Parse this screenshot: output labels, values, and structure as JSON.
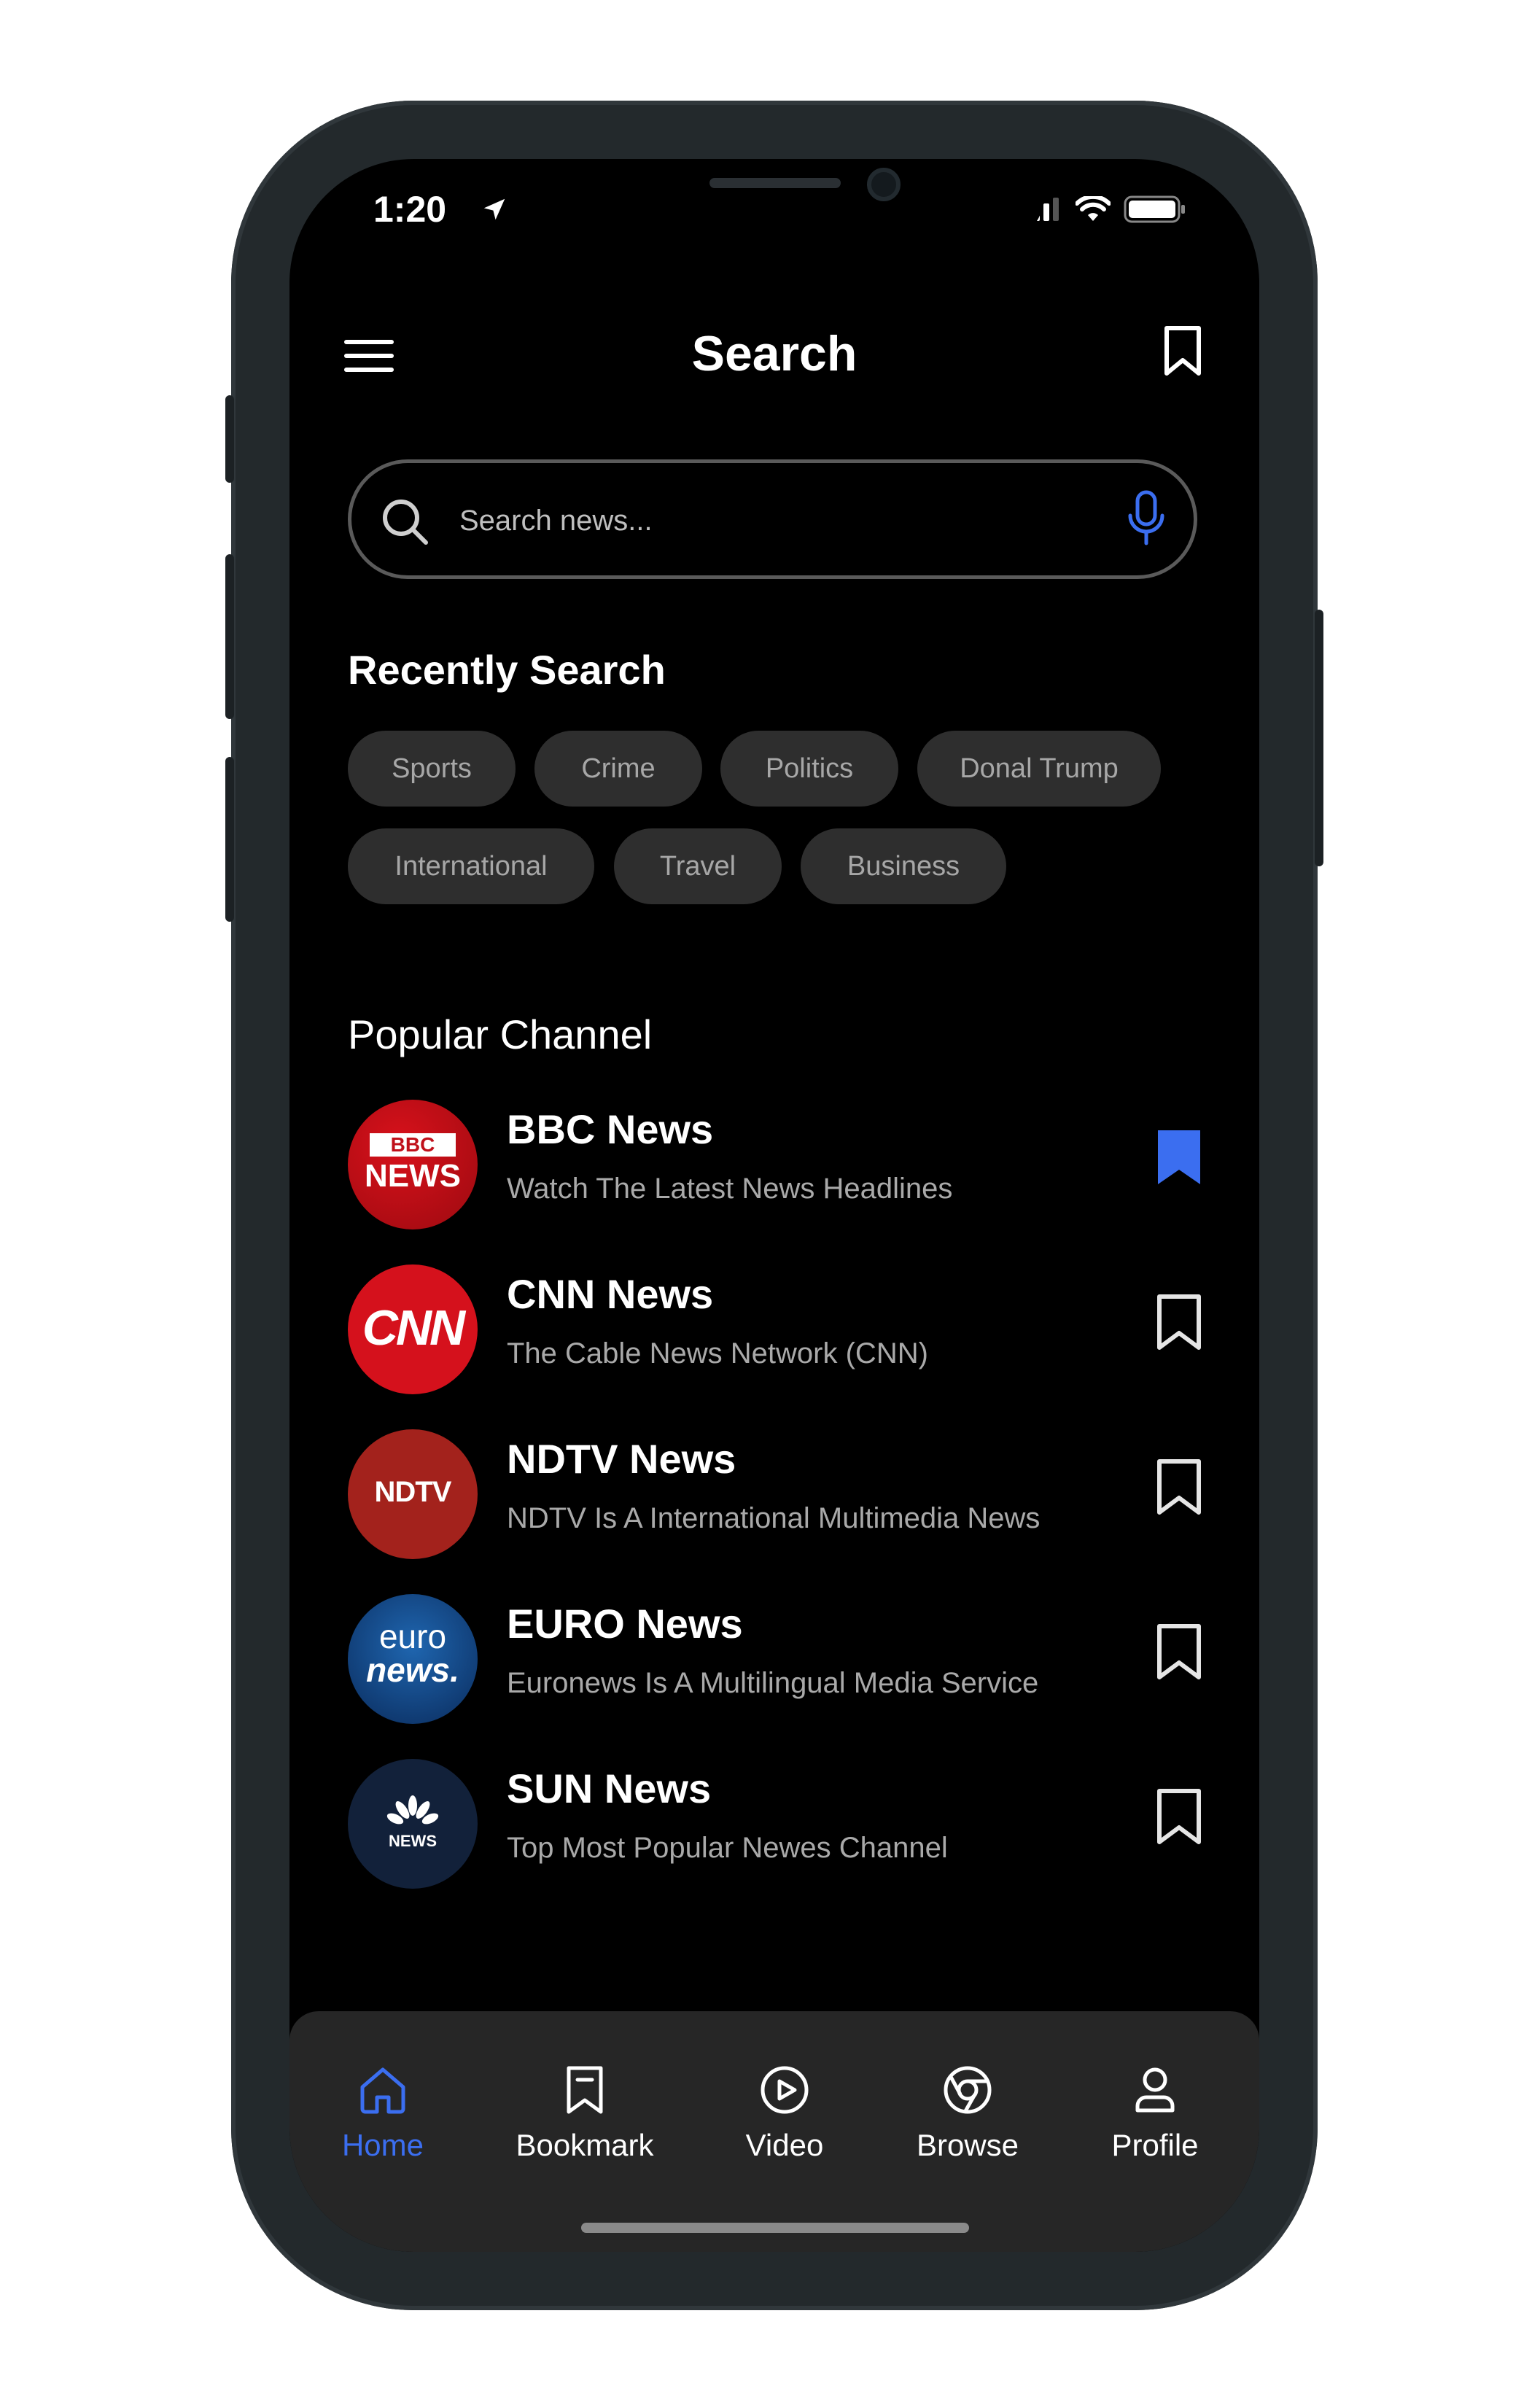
{
  "status_bar": {
    "time": "1:20"
  },
  "header": {
    "title": "Search"
  },
  "search": {
    "placeholder": "Search news..."
  },
  "recent": {
    "title": "Recently Search",
    "chips": [
      "Sports",
      "Crime",
      "Politics",
      "Donal Trump",
      "International",
      "Travel",
      "Business"
    ]
  },
  "popular": {
    "title": "Popular Channel",
    "channels": [
      {
        "name": "BBC News",
        "desc": "Watch The Latest News Headlines",
        "logo_line1": "BBC",
        "logo_line2": "NEWS",
        "bookmarked": true
      },
      {
        "name": "CNN News",
        "desc": "The Cable News Network (CNN)",
        "logo_line1": "CNN",
        "bookmarked": false
      },
      {
        "name": "NDTV News",
        "desc": "NDTV Is A International Multimedia News",
        "logo_line1": "NDTV",
        "bookmarked": false
      },
      {
        "name": "EURO News",
        "desc": "Euronews Is A Multilingual Media Service",
        "logo_line1": "euro",
        "logo_line2": "news.",
        "bookmarked": false
      },
      {
        "name": "SUN News",
        "desc": "Top Most Popular Newes Channel",
        "logo_line1": "NEWS",
        "bookmarked": false
      }
    ]
  },
  "tabs": {
    "home": "Home",
    "bookmark": "Bookmark",
    "video": "Video",
    "browse": "Browse",
    "profile": "Profile"
  },
  "colors": {
    "accent": "#3b6ef0",
    "background": "#000000",
    "chip": "#2e2e2e",
    "tabbar": "#262626"
  }
}
